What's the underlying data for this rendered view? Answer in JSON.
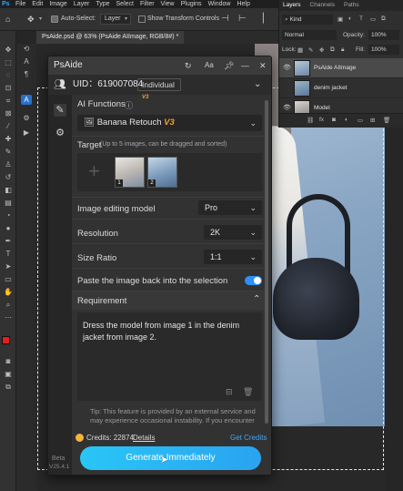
{
  "menubar": {
    "logo": "Ps",
    "items": [
      "File",
      "Edit",
      "Image",
      "Layer",
      "Type",
      "Select",
      "Filter",
      "View",
      "Plugins",
      "Window",
      "Help"
    ]
  },
  "optbar": {
    "auto_select_label": "Auto-Select:",
    "auto_select_value": "Layer",
    "transform_label": "Show Transform Controls"
  },
  "document_tab": {
    "title": "PsAide.psd @ 63% (PsAide AIImage, RGB/8#) *"
  },
  "layers_panel": {
    "tabs": [
      "Layers",
      "Channels",
      "Paths"
    ],
    "kind_label": "Kind",
    "blend_mode": "Normal",
    "opacity_label": "Opacity:",
    "opacity_value": "100%",
    "lock_label": "Lock:",
    "fill_label": "Fill:",
    "fill_value": "100%",
    "layers": [
      {
        "name": "PsAide AIImage",
        "selected": true
      },
      {
        "name": "denim jacket",
        "selected": false
      },
      {
        "name": "Model",
        "selected": false
      }
    ],
    "fx_label": "fx"
  },
  "plugin": {
    "title": "PsAide",
    "uid_label": "UID：619007084",
    "plan": "Individual",
    "plan_badge": "V3",
    "ai_functions_label": "AI Functions",
    "function_value": "Banana Retouch",
    "function_badge": "V3",
    "target_label": "Target",
    "target_hint": "(Up to 5 images, can be dragged and sorted)",
    "thumb_numbers": [
      "1",
      "2"
    ],
    "model_label": "Image editing model",
    "model_value": "Pro",
    "resolution_label": "Resolution",
    "resolution_value": "2K",
    "size_ratio_label": "Size Ratio",
    "size_ratio_value": "1:1",
    "paste_label": "Paste the image back into the selection",
    "paste_enabled": true,
    "requirement_label": "Requirement",
    "requirement_text": "Dress the model from image 1 in the denim jacket from image 2.",
    "tip_text": "Tip: This feature is provided by an external service and may experience occasional instability. If you encounter",
    "credits_label": "Credits: 22874",
    "details_label": "Details",
    "get_credits_label": "Get Credits",
    "beta_label": "Beta",
    "version_label": "V25.4.1",
    "generate_label": "Generate Immediately"
  },
  "colors": {
    "accent": "#2aa3f0",
    "credits_coin": "#f3b33d",
    "badge": "#f0a12b"
  }
}
